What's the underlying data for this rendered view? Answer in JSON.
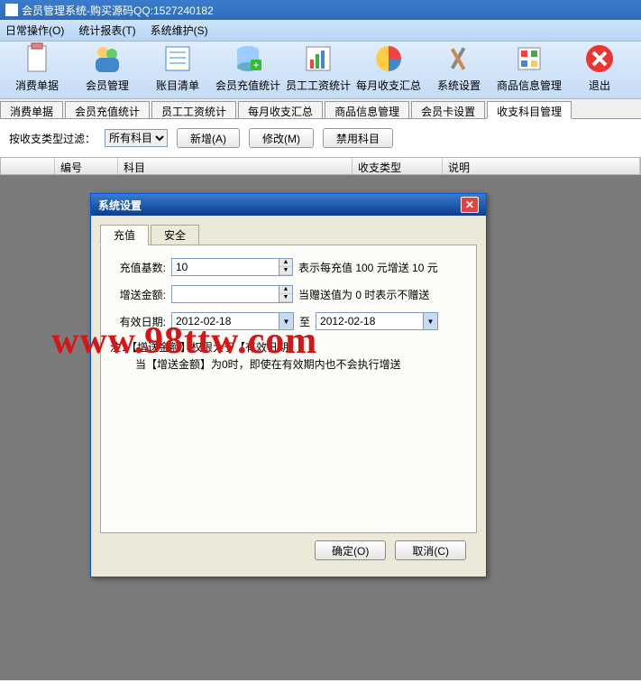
{
  "title": "会员管理系统-购买源码QQ:1527240182",
  "menubar": [
    "日常操作(O)",
    "统计报表(T)",
    "系统维护(S)"
  ],
  "toolbar": [
    {
      "label": "消费单据",
      "name": "tool-consume",
      "icon": "clipboard"
    },
    {
      "label": "会员管理",
      "name": "tool-member",
      "icon": "people"
    },
    {
      "label": "账目清单",
      "name": "tool-account",
      "icon": "list"
    },
    {
      "label": "会员充值统计",
      "name": "tool-recharge",
      "icon": "db"
    },
    {
      "label": "员工工资统计",
      "name": "tool-salary",
      "icon": "chart"
    },
    {
      "label": "每月收支汇总",
      "name": "tool-monthly",
      "icon": "pie"
    },
    {
      "label": "系统设置",
      "name": "tool-settings",
      "icon": "tools"
    },
    {
      "label": "商品信息管理",
      "name": "tool-goods",
      "icon": "grid"
    },
    {
      "label": "退出",
      "name": "tool-exit",
      "icon": "exit"
    }
  ],
  "tabs": [
    "消费单据",
    "会员充值统计",
    "员工工资统计",
    "每月收支汇总",
    "商品信息管理",
    "会员卡设置",
    "收支科目管理"
  ],
  "active_tab": 6,
  "filter": {
    "label": "按收支类型过滤：",
    "select_value": "所有科目",
    "btn_add": "新增(A)",
    "btn_edit": "修改(M)",
    "btn_disable": "禁用科目"
  },
  "columns": [
    "",
    "编号",
    "科目",
    "收支类型",
    "说明"
  ],
  "modal": {
    "title": "系统设置",
    "inner_tabs": [
      "充值",
      "安全"
    ],
    "active_inner": 0,
    "row1_label": "充值基数:",
    "row1_value": "10",
    "row1_desc": "表示每充值 100 元增送 10 元",
    "row2_label": "增送金额:",
    "row2_value": "",
    "row2_desc": "当赠送值为 0 时表示不赠送",
    "row3_label": "有效日期:",
    "date_from": "2012-02-18",
    "date_to_label": "至",
    "date_to": "2012-02-18",
    "note1": "注：【增送金额】权限大于【有效日期】",
    "note2": "当【增送金额】为0时，即使在有效期内也不会执行增送",
    "btn_ok": "确定(O)",
    "btn_cancel": "取消(C)"
  },
  "watermark": "www.98ttw.com"
}
